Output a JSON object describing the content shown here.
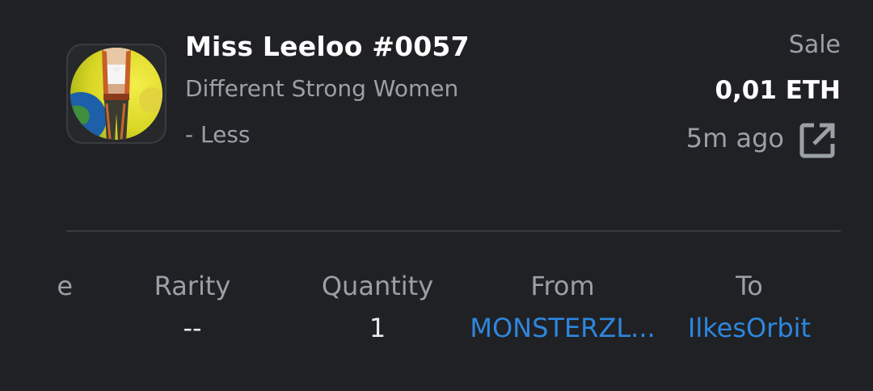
{
  "item": {
    "title": "Miss Leeloo #0057",
    "collection": "Different Strong Women",
    "toggle_label": "- Less"
  },
  "transaction": {
    "event": "Sale",
    "price": "0,01 ETH",
    "time": "5m ago"
  },
  "stats": {
    "cut_label": "e",
    "rarity": {
      "label": "Rarity",
      "value": "--"
    },
    "quantity": {
      "label": "Quantity",
      "value": "1"
    },
    "from": {
      "label": "From",
      "value": "MONSTERZL..."
    },
    "to": {
      "label": "To",
      "value": "IlkesOrbit"
    }
  },
  "colors": {
    "background": "#202124",
    "text_primary": "#ffffff",
    "text_secondary": "#9aa0a6",
    "link": "#2e86de",
    "divider": "#3a3c40"
  },
  "icons": {
    "external_link": "open-in-new-icon"
  }
}
